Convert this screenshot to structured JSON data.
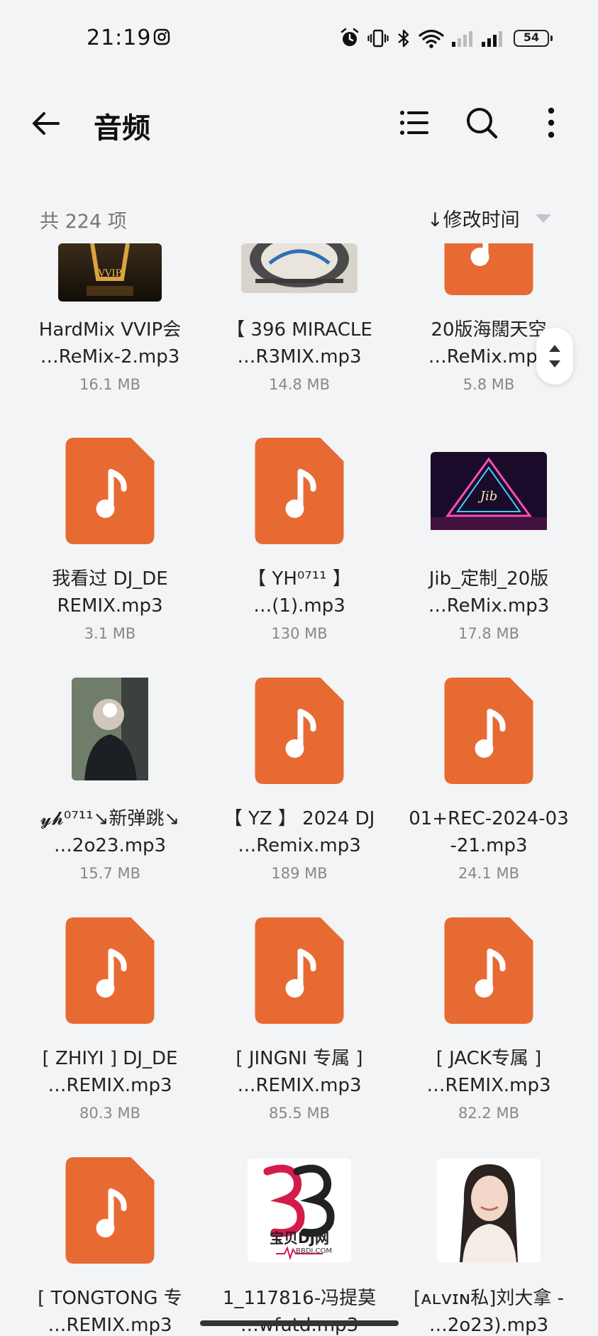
{
  "status_bar": {
    "time": "21:19",
    "battery": "54"
  },
  "app_bar": {
    "title": "音频",
    "back_icon": "arrow-left-icon",
    "view_icon": "list-view-icon",
    "search_icon": "search-icon",
    "more_icon": "more-vertical-icon"
  },
  "toolbar": {
    "count": "共 224 项",
    "sort_label": "↓修改时间"
  },
  "colors": {
    "accent_orange": "#e76a33",
    "background": "#f3f4f6"
  },
  "files": [
    {
      "line1": "HardMix VVIP会",
      "line2": "…ReMix-2.mp3",
      "size": "16.1 MB",
      "thumb": "image"
    },
    {
      "line1": "【 396 MIRACLE",
      "line2": "…R3MIX.mp3",
      "size": "14.8 MB",
      "thumb": "image"
    },
    {
      "line1": "20版海闊天空",
      "line2": "…ReMix.mp3",
      "size": "5.8 MB",
      "thumb": "music-file-icon"
    },
    {
      "line1": "我看过 DJ_DE",
      "line2": "REMIX.mp3",
      "size": "3.1 MB",
      "thumb": "music-file-icon"
    },
    {
      "line1": "【 YH⁰⁷¹¹ 】",
      "line2": "…(1).mp3",
      "size": "130 MB",
      "thumb": "music-file-icon"
    },
    {
      "line1": "Jib_定制_20版",
      "line2": "…ReMix.mp3",
      "size": "17.8 MB",
      "thumb": "image"
    },
    {
      "line1": "𝔂𝓱⁰⁷¹¹↘新弹跳↘",
      "line2": "…2o23.mp3",
      "size": "15.7 MB",
      "thumb": "image"
    },
    {
      "line1": "【 YZ 】 2024 DJ",
      "line2": "…Remix.mp3",
      "size": "189 MB",
      "thumb": "music-file-icon"
    },
    {
      "line1": "01+REC-2024-03",
      "line2": "-21.mp3",
      "size": "24.1 MB",
      "thumb": "music-file-icon"
    },
    {
      "line1": "[ ZHIYI ] DJ_DE",
      "line2": "…REMIX.mp3",
      "size": "80.3 MB",
      "thumb": "music-file-icon"
    },
    {
      "line1": "[ JINGNI 专属 ]",
      "line2": "…REMIX.mp3",
      "size": "85.5 MB",
      "thumb": "music-file-icon"
    },
    {
      "line1": "[ JACK专属 ]",
      "line2": "…REMIX.mp3",
      "size": "82.2 MB",
      "thumb": "music-file-icon"
    },
    {
      "line1": "[ TONGTONG 专",
      "line2": "…REMIX.mp3",
      "size": "",
      "thumb": "music-file-icon"
    },
    {
      "line1": "1_117816-冯提莫",
      "line2": "…wfutd.mp3",
      "size": "",
      "thumb": "image",
      "logo_text": "宝贝DJ网",
      "logo_sub": "BBDJ.COM"
    },
    {
      "line1": "[ᴀʟᴠɪɴ私]刘大拿 -",
      "line2": "…2o23).mp3",
      "size": "",
      "thumb": "image"
    }
  ]
}
